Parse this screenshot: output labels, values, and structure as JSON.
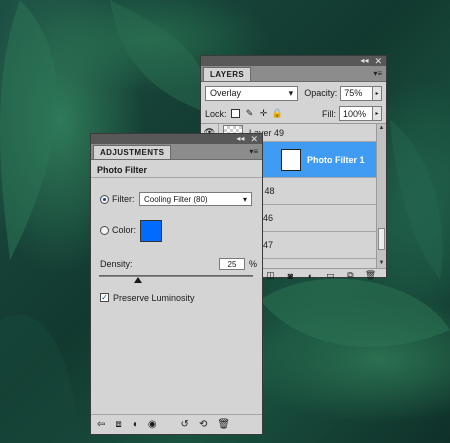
{
  "background": {
    "description_icon": "leaf-photo-icon"
  },
  "layers_panel": {
    "tab": "LAYERS",
    "blend_mode": "Overlay",
    "opacity_label": "Opacity:",
    "opacity_value": "75%",
    "lock_label": "Lock:",
    "fill_label": "Fill:",
    "fill_value": "100%",
    "layers": [
      {
        "name": "Layer 49",
        "selected": false,
        "visible": true
      },
      {
        "name": "Photo Filter 1",
        "selected": true,
        "visible": false
      },
      {
        "name": "r 48",
        "selected": false,
        "visible": false
      },
      {
        "name": "46",
        "selected": false,
        "visible": false
      },
      {
        "name": "47",
        "selected": false,
        "visible": false
      }
    ],
    "footer_icons": [
      "link-icon",
      "fx-icon",
      "mask-icon",
      "adjustment-layer-icon",
      "group-folder-icon",
      "new-layer-icon",
      "trash-icon"
    ]
  },
  "adjust_panel": {
    "tab": "ADJUSTMENTS",
    "title": "Photo Filter",
    "filter_label": "Filter:",
    "filter_value": "Cooling Filter (80)",
    "color_label": "Color:",
    "color_hex": "#006bfc",
    "density_label": "Density:",
    "density_value": "25",
    "density_unit": "%",
    "density_level": 0.25,
    "preserve_label": "Preserve Luminosity",
    "preserve_checked": true,
    "footer_icons": [
      "return-arrow-icon",
      "expanded-view-icon",
      "clip-layer-icon",
      "visibility-eye-icon",
      "previous-state-icon",
      "reset-icon",
      "trash-icon"
    ]
  }
}
